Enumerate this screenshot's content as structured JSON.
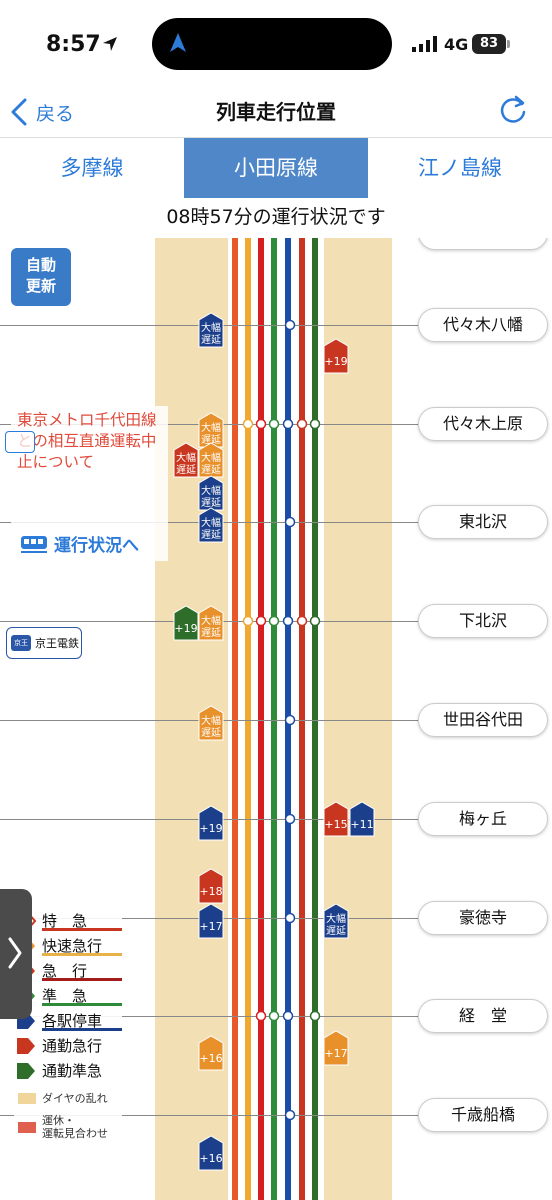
{
  "status_bar": {
    "time": "8:57",
    "network": "4G",
    "battery": "83"
  },
  "nav": {
    "back_label": "戻る",
    "title": "列車走行位置"
  },
  "tabs": [
    {
      "label": "多摩線",
      "active": false
    },
    {
      "label": "小田原線",
      "active": true
    },
    {
      "label": "江ノ島線",
      "active": false
    }
  ],
  "status_text": "08時57分の運行状況です",
  "auto_update_label": [
    "自動",
    "更新"
  ],
  "notice": {
    "text": "東京メトロ千代田線との相互直通運転中止について",
    "link_label": "運行状況へ"
  },
  "keio_label": "京王電鉄",
  "keio_logo": "京王",
  "stations": [
    "代々木八幡",
    "代々木上原",
    "東北沢",
    "下北沢",
    "世田谷代田",
    "梅ヶ丘",
    "豪徳寺",
    "経　堂",
    "千歳船橋"
  ],
  "train_markers": [
    {
      "color": "#1b3f8a",
      "text": [
        "大幅",
        "遅延"
      ]
    },
    {
      "color": "#c8361f",
      "text": [
        "+19"
      ]
    },
    {
      "color": "#e8902a",
      "text": [
        "大幅",
        "遅延"
      ]
    },
    {
      "color": "#c8361f",
      "text": [
        "大幅",
        "遅延"
      ]
    },
    {
      "color": "#e8902a",
      "text": [
        "大幅",
        "遅延"
      ]
    },
    {
      "color": "#1b3f8a",
      "text": [
        "大幅",
        "遅延"
      ]
    },
    {
      "color": "#1b3f8a",
      "text": [
        "大幅",
        "遅延"
      ]
    },
    {
      "color": "#2e6d2a",
      "text": [
        "+19"
      ]
    },
    {
      "color": "#e8902a",
      "text": [
        "大幅",
        "遅延"
      ]
    },
    {
      "color": "#e8902a",
      "text": [
        "大幅",
        "遅延"
      ]
    },
    {
      "color": "#1b3f8a",
      "text": [
        "+19"
      ]
    },
    {
      "color": "#c8361f",
      "text": [
        "+15"
      ]
    },
    {
      "color": "#1b3f8a",
      "text": [
        "+11"
      ]
    },
    {
      "color": "#c8361f",
      "text": [
        "+18"
      ]
    },
    {
      "color": "#1b3f8a",
      "text": [
        "+17"
      ]
    },
    {
      "color": "#1b3f8a",
      "text": [
        "大幅",
        "遅延"
      ]
    },
    {
      "color": "#e8902a",
      "text": [
        "+16"
      ]
    },
    {
      "color": "#e8902a",
      "text": [
        "+17"
      ]
    },
    {
      "color": "#1b3f8a",
      "text": [
        "+16"
      ]
    }
  ],
  "legend": {
    "items": [
      {
        "label": "特　急",
        "color": "#e0a98c",
        "underline": "#c8361f"
      },
      {
        "label": "快速急行",
        "color": "#e8902a",
        "underline": "#e8b24a"
      },
      {
        "label": "急　行",
        "color": "#c8361f",
        "underline": "#a51c1c"
      },
      {
        "label": "準　急",
        "color": "#2e8b3a",
        "underline": "#2e8b3a"
      },
      {
        "label": "各駅停車",
        "color": "#1b3f8a",
        "underline": "#1b3f8a"
      },
      {
        "label": "通勤急行",
        "color": "#c8361f",
        "underline": ""
      },
      {
        "label": "通勤準急",
        "color": "#2e6d2a",
        "underline": ""
      }
    ],
    "diagram_disruption": "ダイヤの乱れ",
    "suspended": [
      "運休・",
      "運転見合わせ"
    ],
    "disruption_color": "#f0d69a",
    "suspended_color": "#e06050"
  },
  "track_colors": [
    "#e8592a",
    "#f0a830",
    "#d42020",
    "#2e8b3a",
    "#1b4ca8",
    "#c8361f",
    "#2e6d2a"
  ]
}
